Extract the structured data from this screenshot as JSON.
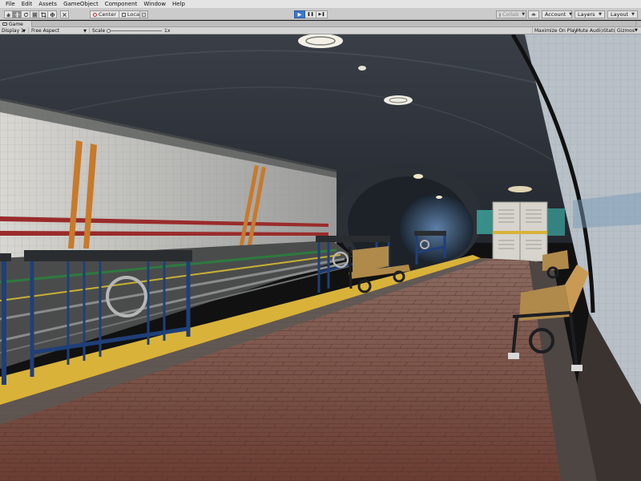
{
  "menu": [
    "File",
    "Edit",
    "Assets",
    "GameObject",
    "Component",
    "Window",
    "Help"
  ],
  "toolbar": {
    "tools": [
      "hand-icon",
      "move-icon",
      "rotate-icon",
      "scale-icon",
      "rect-icon",
      "transform-icon",
      "custom-tool-icon"
    ],
    "pivot_label": "Center",
    "space_label": "Local",
    "play_label": "▶",
    "pause_label": "❚❚",
    "step_label": "▶❚",
    "collab_label": "Collab",
    "account_label": "Account",
    "layers_label": "Layers",
    "layout_label": "Layout"
  },
  "tab": {
    "label": "Game"
  },
  "gameview": {
    "display_label": "Display 1",
    "aspect_label": "Free Aspect",
    "scale_label": "Scale",
    "scale_value": "1x",
    "maximize_label": "Maximize On Play",
    "mute_label": "Mute Audio",
    "stats_label": "Stats",
    "gizmos_label": "Gizmos"
  },
  "scene": {
    "description_colors": {
      "tile": "#d9d8d2",
      "stripe_red": "#9a2b2b",
      "stripe_orange": "#c87a2a",
      "platform_brick": "#7a4a3c",
      "edge_yellow": "#d9b23a",
      "railing_blue": "#1f3f78"
    }
  }
}
